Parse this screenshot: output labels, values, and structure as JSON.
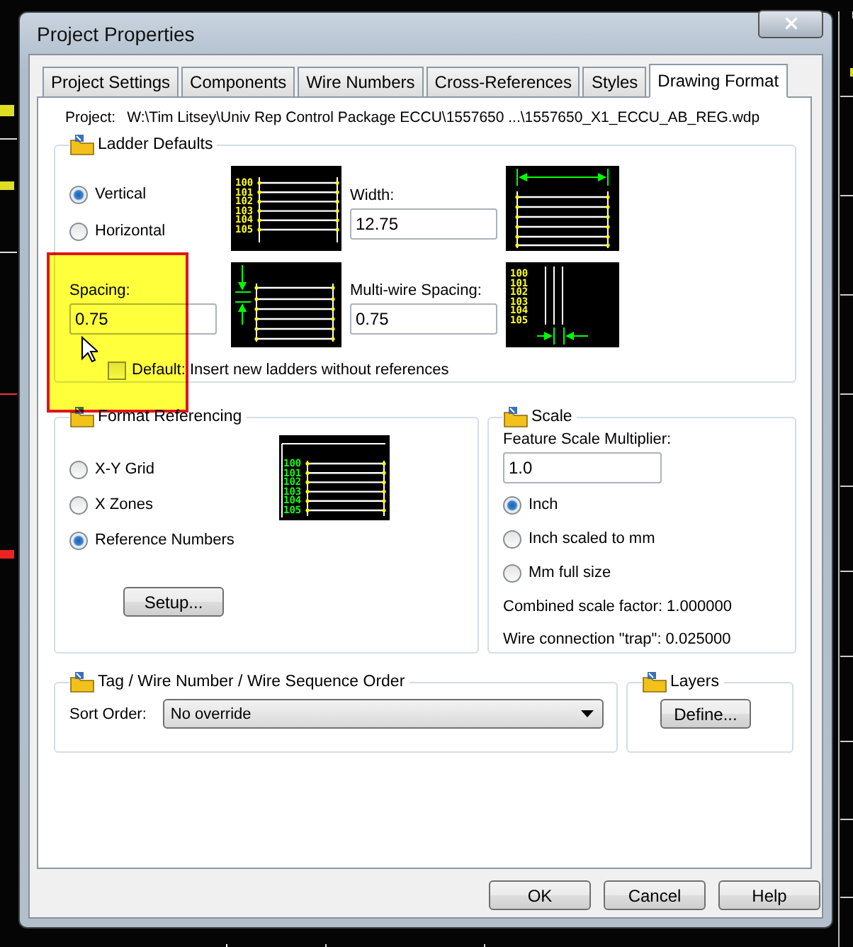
{
  "window": {
    "title": "Project Properties"
  },
  "tabs": [
    {
      "label": "Project Settings",
      "selected": false
    },
    {
      "label": "Components",
      "selected": false
    },
    {
      "label": "Wire Numbers",
      "selected": false
    },
    {
      "label": "Cross-References",
      "selected": false
    },
    {
      "label": "Styles",
      "selected": false
    },
    {
      "label": "Drawing Format",
      "selected": true
    }
  ],
  "project": {
    "label": "Project:",
    "path": "W:\\Tim Litsey\\Univ Rep Control Package ECCU\\1557650 ...\\1557650_X1_ECCU_AB_REG.wdp"
  },
  "ladder_defaults": {
    "title": "Ladder Defaults",
    "orientation": [
      {
        "label": "Vertical",
        "selected": true
      },
      {
        "label": "Horizontal",
        "selected": false
      }
    ],
    "spacing": {
      "label": "Spacing:",
      "value": "0.75"
    },
    "width": {
      "label": "Width:",
      "value": "12.75"
    },
    "multiwire_spacing": {
      "label": "Multi-wire Spacing:",
      "value": "0.75"
    },
    "default_checkbox": {
      "label": "Default: Insert new ladders without references",
      "checked": false
    },
    "previews": [
      {
        "kind": "numbered",
        "numbers": [
          "100",
          "101",
          "102",
          "103",
          "104",
          "105"
        ]
      },
      {
        "kind": "spacing"
      },
      {
        "kind": "width"
      },
      {
        "kind": "multiwire",
        "numbers": [
          "100",
          "101",
          "102",
          "103",
          "104",
          "105"
        ]
      }
    ]
  },
  "format_referencing": {
    "title": "Format Referencing",
    "options": [
      {
        "label": "X-Y Grid",
        "selected": false
      },
      {
        "label": "X Zones",
        "selected": false
      },
      {
        "label": "Reference Numbers",
        "selected": true
      }
    ],
    "preview": {
      "kind": "reference",
      "numbers": [
        "100",
        "101",
        "102",
        "103",
        "104",
        "105"
      ]
    },
    "setup_button": "Setup..."
  },
  "scale": {
    "title": "Scale",
    "multiplier": {
      "label": "Feature Scale Multiplier:",
      "value": "1.0"
    },
    "units": [
      {
        "label": "Inch",
        "selected": true
      },
      {
        "label": "Inch scaled to mm",
        "selected": false
      },
      {
        "label": "Mm full size",
        "selected": false
      }
    ],
    "combined": "Combined scale factor: 1.000000",
    "trap": "Wire connection \"trap\": 0.025000"
  },
  "sort_order": {
    "title": "Tag / Wire Number / Wire Sequence Order",
    "label": "Sort Order:",
    "value": "No override"
  },
  "layers": {
    "title": "Layers",
    "button": "Define..."
  },
  "buttons": [
    "OK",
    "Cancel",
    "Help"
  ]
}
